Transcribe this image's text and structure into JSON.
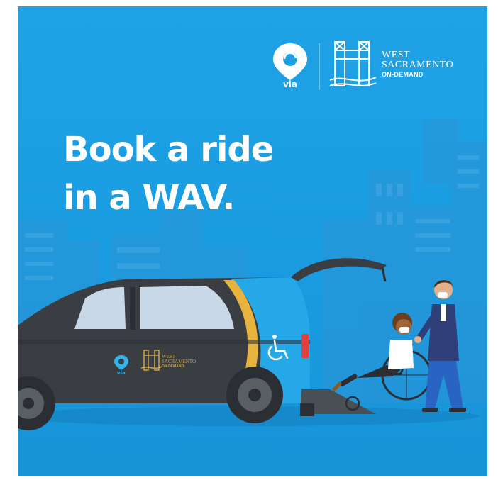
{
  "headline": {
    "line1": "Book a ride",
    "line2": "in a WAV."
  },
  "brand": {
    "via_wordmark": "via",
    "partner_line1": "WEST",
    "partner_line2": "SACRAMENTO",
    "partner_line3": "ON-DEMAND"
  },
  "van_decal": {
    "via_wordmark": "via",
    "partner_line1": "WEST",
    "partner_line2": "SACRAMENTO",
    "partner_line3": "ON-DEMAND"
  },
  "icons": [
    "via-logo-icon",
    "tower-bridge-logo-icon",
    "wheelchair-accessible-icon"
  ],
  "colors": {
    "background": "#1da0e3",
    "van_body": "#3a3d42",
    "van_accent": "#26a8e8",
    "stripe": "#e8b33c",
    "headline_text": "#ffffff",
    "partner_gold": "#c9a646"
  }
}
